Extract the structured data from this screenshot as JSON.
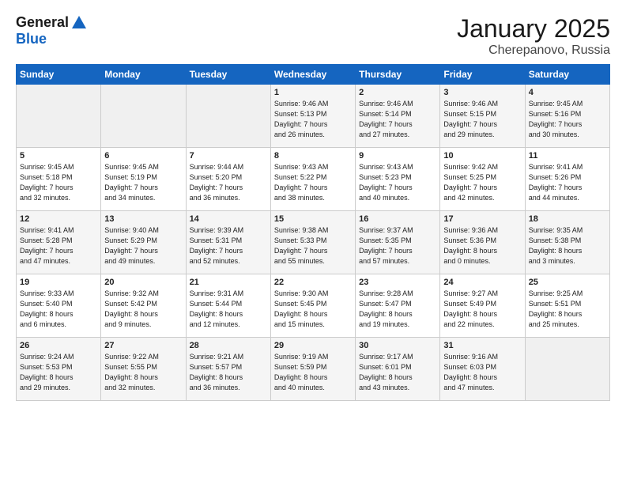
{
  "logo": {
    "line1": "General",
    "line2": "Blue"
  },
  "title": "January 2025",
  "subtitle": "Cherepanovo, Russia",
  "days_header": [
    "Sunday",
    "Monday",
    "Tuesday",
    "Wednesday",
    "Thursday",
    "Friday",
    "Saturday"
  ],
  "weeks": [
    [
      {
        "day": "",
        "info": ""
      },
      {
        "day": "",
        "info": ""
      },
      {
        "day": "",
        "info": ""
      },
      {
        "day": "1",
        "info": "Sunrise: 9:46 AM\nSunset: 5:13 PM\nDaylight: 7 hours\nand 26 minutes."
      },
      {
        "day": "2",
        "info": "Sunrise: 9:46 AM\nSunset: 5:14 PM\nDaylight: 7 hours\nand 27 minutes."
      },
      {
        "day": "3",
        "info": "Sunrise: 9:46 AM\nSunset: 5:15 PM\nDaylight: 7 hours\nand 29 minutes."
      },
      {
        "day": "4",
        "info": "Sunrise: 9:45 AM\nSunset: 5:16 PM\nDaylight: 7 hours\nand 30 minutes."
      }
    ],
    [
      {
        "day": "5",
        "info": "Sunrise: 9:45 AM\nSunset: 5:18 PM\nDaylight: 7 hours\nand 32 minutes."
      },
      {
        "day": "6",
        "info": "Sunrise: 9:45 AM\nSunset: 5:19 PM\nDaylight: 7 hours\nand 34 minutes."
      },
      {
        "day": "7",
        "info": "Sunrise: 9:44 AM\nSunset: 5:20 PM\nDaylight: 7 hours\nand 36 minutes."
      },
      {
        "day": "8",
        "info": "Sunrise: 9:43 AM\nSunset: 5:22 PM\nDaylight: 7 hours\nand 38 minutes."
      },
      {
        "day": "9",
        "info": "Sunrise: 9:43 AM\nSunset: 5:23 PM\nDaylight: 7 hours\nand 40 minutes."
      },
      {
        "day": "10",
        "info": "Sunrise: 9:42 AM\nSunset: 5:25 PM\nDaylight: 7 hours\nand 42 minutes."
      },
      {
        "day": "11",
        "info": "Sunrise: 9:41 AM\nSunset: 5:26 PM\nDaylight: 7 hours\nand 44 minutes."
      }
    ],
    [
      {
        "day": "12",
        "info": "Sunrise: 9:41 AM\nSunset: 5:28 PM\nDaylight: 7 hours\nand 47 minutes."
      },
      {
        "day": "13",
        "info": "Sunrise: 9:40 AM\nSunset: 5:29 PM\nDaylight: 7 hours\nand 49 minutes."
      },
      {
        "day": "14",
        "info": "Sunrise: 9:39 AM\nSunset: 5:31 PM\nDaylight: 7 hours\nand 52 minutes."
      },
      {
        "day": "15",
        "info": "Sunrise: 9:38 AM\nSunset: 5:33 PM\nDaylight: 7 hours\nand 55 minutes."
      },
      {
        "day": "16",
        "info": "Sunrise: 9:37 AM\nSunset: 5:35 PM\nDaylight: 7 hours\nand 57 minutes."
      },
      {
        "day": "17",
        "info": "Sunrise: 9:36 AM\nSunset: 5:36 PM\nDaylight: 8 hours\nand 0 minutes."
      },
      {
        "day": "18",
        "info": "Sunrise: 9:35 AM\nSunset: 5:38 PM\nDaylight: 8 hours\nand 3 minutes."
      }
    ],
    [
      {
        "day": "19",
        "info": "Sunrise: 9:33 AM\nSunset: 5:40 PM\nDaylight: 8 hours\nand 6 minutes."
      },
      {
        "day": "20",
        "info": "Sunrise: 9:32 AM\nSunset: 5:42 PM\nDaylight: 8 hours\nand 9 minutes."
      },
      {
        "day": "21",
        "info": "Sunrise: 9:31 AM\nSunset: 5:44 PM\nDaylight: 8 hours\nand 12 minutes."
      },
      {
        "day": "22",
        "info": "Sunrise: 9:30 AM\nSunset: 5:45 PM\nDaylight: 8 hours\nand 15 minutes."
      },
      {
        "day": "23",
        "info": "Sunrise: 9:28 AM\nSunset: 5:47 PM\nDaylight: 8 hours\nand 19 minutes."
      },
      {
        "day": "24",
        "info": "Sunrise: 9:27 AM\nSunset: 5:49 PM\nDaylight: 8 hours\nand 22 minutes."
      },
      {
        "day": "25",
        "info": "Sunrise: 9:25 AM\nSunset: 5:51 PM\nDaylight: 8 hours\nand 25 minutes."
      }
    ],
    [
      {
        "day": "26",
        "info": "Sunrise: 9:24 AM\nSunset: 5:53 PM\nDaylight: 8 hours\nand 29 minutes."
      },
      {
        "day": "27",
        "info": "Sunrise: 9:22 AM\nSunset: 5:55 PM\nDaylight: 8 hours\nand 32 minutes."
      },
      {
        "day": "28",
        "info": "Sunrise: 9:21 AM\nSunset: 5:57 PM\nDaylight: 8 hours\nand 36 minutes."
      },
      {
        "day": "29",
        "info": "Sunrise: 9:19 AM\nSunset: 5:59 PM\nDaylight: 8 hours\nand 40 minutes."
      },
      {
        "day": "30",
        "info": "Sunrise: 9:17 AM\nSunset: 6:01 PM\nDaylight: 8 hours\nand 43 minutes."
      },
      {
        "day": "31",
        "info": "Sunrise: 9:16 AM\nSunset: 6:03 PM\nDaylight: 8 hours\nand 47 minutes."
      },
      {
        "day": "",
        "info": ""
      }
    ]
  ]
}
